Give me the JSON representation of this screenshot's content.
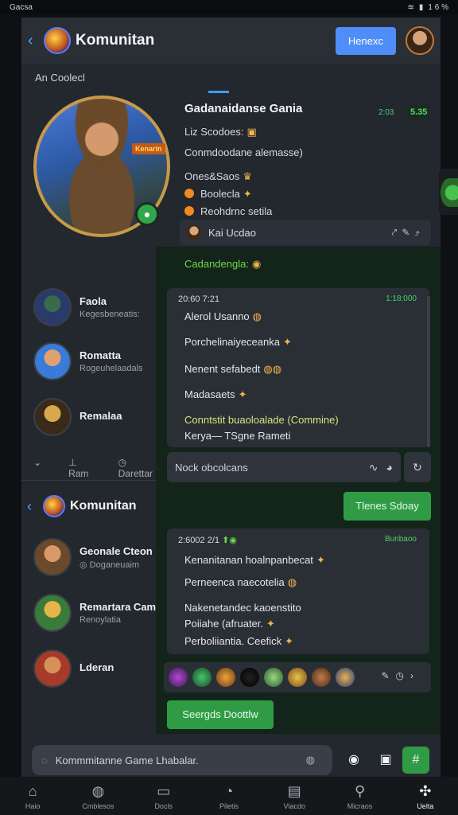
{
  "status": {
    "left": "Gacsa",
    "right": "1 6 %"
  },
  "header": {
    "title": "Komunitan",
    "button": "Henexc"
  },
  "section_label": "An Coolecl",
  "game": {
    "tag": "Kenarin",
    "name": "Gadanaidanse Gania",
    "time": "2:03",
    "count": "5.35",
    "line1": "Liz Scodoes:",
    "line2": "Conmdoodane alemasse)",
    "line3": "Ones&Saos",
    "line4": "Boolecla",
    "line5": "Reohdrnc setila",
    "host": "Kai Ucdao"
  },
  "chat": {
    "header": "Cadandengla:",
    "bubble1": {
      "time": "20:60 7:21",
      "time_right": "1:18:000",
      "lines": [
        "Alerol Usanno",
        "Porchelinaiyeceanka",
        "Nenent sefabedt",
        "Madasaets",
        "Conntstit  buaoloalade (Commine)",
        "Kerya—  TSgne Rameti"
      ]
    },
    "message_placeholder": "Nock obcolcans",
    "button1": "Tlenes Sdoay",
    "bubble2": {
      "time": "2:6002 2/1",
      "time_right": "Bunbaoo",
      "lines": [
        "Kenanitanan hoalnpanbecat",
        "Perneenca naecotelia",
        "Nakenetandec kaoenstito",
        "Poiiahe (afruater.",
        "Perboliiantia. Ceefick"
      ]
    },
    "button2": "Seergds Doottlw"
  },
  "members": [
    {
      "name": "Faola",
      "sub": "Kegesbeneatis:"
    },
    {
      "name": "Romatta",
      "sub": "Rogeuhelaadals"
    },
    {
      "name": "Remalaa",
      "sub": ""
    }
  ],
  "list_controls": [
    "Ram",
    "Darettar"
  ],
  "sub_header": {
    "title": "Komunitan"
  },
  "members2": [
    {
      "name": "Geonale Cteon",
      "sub": "Doganeuaim"
    },
    {
      "name": "Remartara Cam",
      "sub": "Renoylatia"
    },
    {
      "name": "Lderan",
      "sub": ""
    }
  ],
  "composer": {
    "placeholder": "Kommmitanne Game Lhabalar."
  },
  "nav": [
    {
      "label": "Haio",
      "icon": "home-icon"
    },
    {
      "label": "Cmblesos",
      "icon": "shield-icon"
    },
    {
      "label": "Docls",
      "icon": "book-icon"
    },
    {
      "label": "Piletis",
      "icon": "compass-icon"
    },
    {
      "label": "Vlacdo",
      "icon": "map-icon"
    },
    {
      "label": "Micraos",
      "icon": "search-icon"
    },
    {
      "label": "Uelta",
      "icon": "puzzle-icon"
    }
  ],
  "colors": {
    "accent": "#4f8ef7",
    "success": "#2f9c45",
    "online": "#48d16a"
  }
}
